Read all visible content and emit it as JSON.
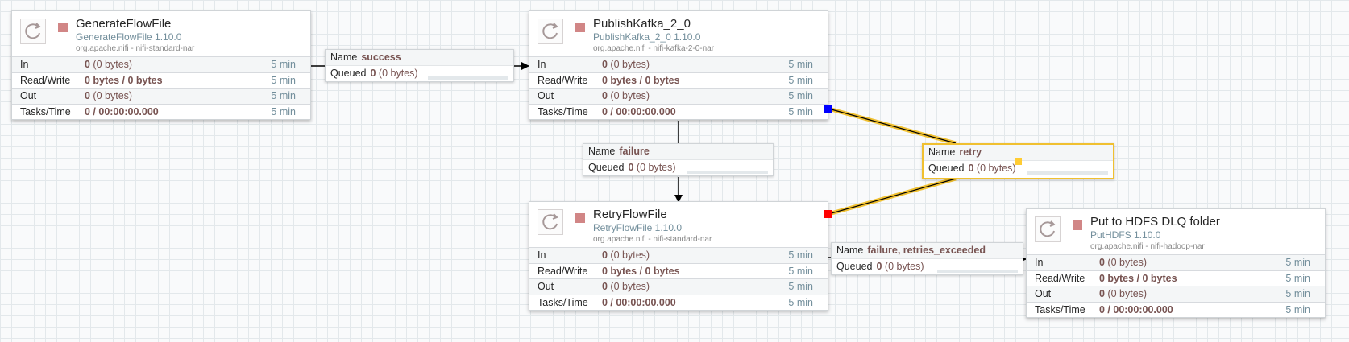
{
  "colors": {
    "canvas_bg": "#f9fafb",
    "stopped_state": "#d18686",
    "stat_value": "#775351",
    "stat_window": "#728e9b",
    "selected_border": "#f0c030",
    "retry_bend_source": "#ff0000",
    "retry_bend_target": "#0000ff",
    "retry_bend_midpoint": "#ffcc33"
  },
  "processors": [
    {
      "name": "GenerateFlowFile",
      "type": "GenerateFlowFile 1.10.0",
      "bundle": "org.apache.nifi - nifi-standard-nar",
      "state_icon": "stopped-square-icon",
      "restricted": false,
      "stats": [
        {
          "label": "In",
          "value_bold": "0",
          "value_rest": " (0 bytes)",
          "window": "5 min"
        },
        {
          "label": "Read/Write",
          "value_bold": "0 bytes / 0 bytes",
          "value_rest": "",
          "window": "5 min"
        },
        {
          "label": "Out",
          "value_bold": "0",
          "value_rest": " (0 bytes)",
          "window": "5 min"
        },
        {
          "label": "Tasks/Time",
          "value_bold": "0 / 00:00:00.000",
          "value_rest": "",
          "window": "5 min"
        }
      ]
    },
    {
      "name": "PublishKafka_2_0",
      "type": "PublishKafka_2_0 1.10.0",
      "bundle": "org.apache.nifi - nifi-kafka-2-0-nar",
      "state_icon": "stopped-square-icon",
      "restricted": false,
      "stats": [
        {
          "label": "In",
          "value_bold": "0",
          "value_rest": " (0 bytes)",
          "window": "5 min"
        },
        {
          "label": "Read/Write",
          "value_bold": "0 bytes / 0 bytes",
          "value_rest": "",
          "window": "5 min"
        },
        {
          "label": "Out",
          "value_bold": "0",
          "value_rest": " (0 bytes)",
          "window": "5 min"
        },
        {
          "label": "Tasks/Time",
          "value_bold": "0 / 00:00:00.000",
          "value_rest": "",
          "window": "5 min"
        }
      ]
    },
    {
      "name": "RetryFlowFile",
      "type": "RetryFlowFile 1.10.0",
      "bundle": "org.apache.nifi - nifi-standard-nar",
      "state_icon": "stopped-square-icon",
      "restricted": false,
      "stats": [
        {
          "label": "In",
          "value_bold": "0",
          "value_rest": " (0 bytes)",
          "window": "5 min"
        },
        {
          "label": "Read/Write",
          "value_bold": "0 bytes / 0 bytes",
          "value_rest": "",
          "window": "5 min"
        },
        {
          "label": "Out",
          "value_bold": "0",
          "value_rest": " (0 bytes)",
          "window": "5 min"
        },
        {
          "label": "Tasks/Time",
          "value_bold": "0 / 00:00:00.000",
          "value_rest": "",
          "window": "5 min"
        }
      ]
    },
    {
      "name": "Put to HDFS DLQ folder",
      "type": "PutHDFS 1.10.0",
      "bundle": "org.apache.nifi - nifi-hadoop-nar",
      "state_icon": "stopped-square-icon",
      "restricted": true,
      "stats": [
        {
          "label": "In",
          "value_bold": "0",
          "value_rest": " (0 bytes)",
          "window": "5 min"
        },
        {
          "label": "Read/Write",
          "value_bold": "0 bytes / 0 bytes",
          "value_rest": "",
          "window": "5 min"
        },
        {
          "label": "Out",
          "value_bold": "0",
          "value_rest": " (0 bytes)",
          "window": "5 min"
        },
        {
          "label": "Tasks/Time",
          "value_bold": "0 / 00:00:00.000",
          "value_rest": "",
          "window": "5 min"
        }
      ]
    }
  ],
  "connections": [
    {
      "name_label": "Name",
      "name": "success",
      "queued_label": "Queued",
      "queued_count": "0",
      "queued_size": " (0 bytes)",
      "fill": 0,
      "selected": false
    },
    {
      "name_label": "Name",
      "name": "failure",
      "queued_label": "Queued",
      "queued_count": "0",
      "queued_size": " (0 bytes)",
      "fill": 0,
      "selected": false
    },
    {
      "name_label": "Name",
      "name": "retry",
      "queued_label": "Queued",
      "queued_count": "0",
      "queued_size": " (0 bytes)",
      "fill": 0,
      "selected": true
    },
    {
      "name_label": "Name",
      "name": "failure, retries_exceeded",
      "queued_label": "Queued",
      "queued_count": "0",
      "queued_size": " (0 bytes)",
      "fill": 0,
      "selected": false
    }
  ]
}
